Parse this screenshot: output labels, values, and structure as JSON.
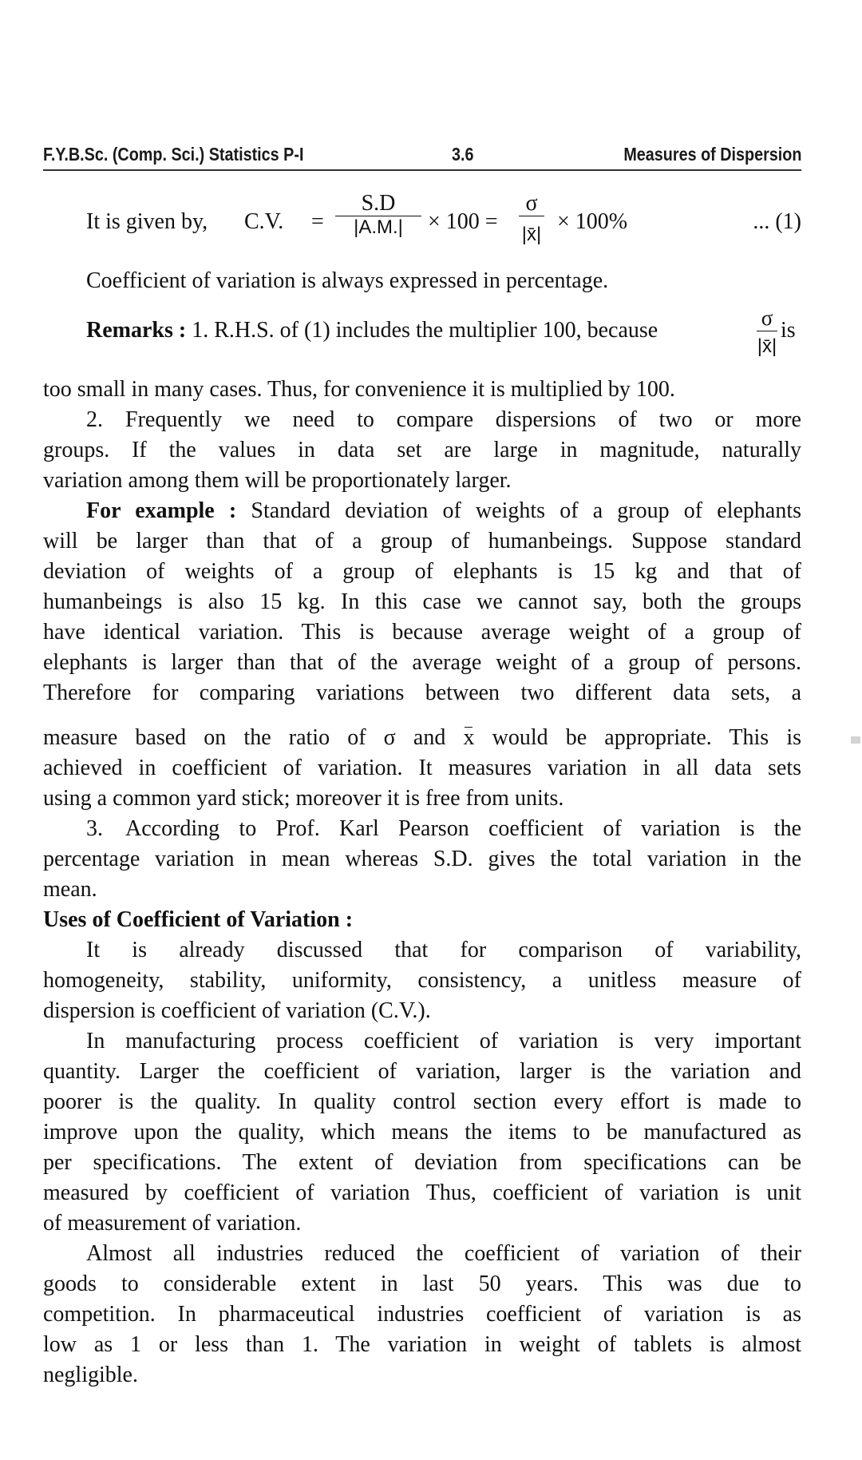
{
  "header": {
    "left": "F.Y.B.Sc. (Comp. Sci.) Statistics P-I",
    "center": "3.6",
    "right": "Measures of Dispersion"
  },
  "formula": {
    "lead": "It is given by,",
    "cv": "C.V.",
    "eq1": "=",
    "frac1_num": "S.D",
    "frac1_den": "|A.M.|",
    "times100": "× 100 =",
    "frac2_num": "σ",
    "frac2_den": "|x̄|",
    "times100pct": "× 100%",
    "eq_number": "... (1)"
  },
  "line_expressed": "Coefficient of variation is always expressed in percentage.",
  "remarks": {
    "label": "Remarks :",
    "text": "1. R.H.S. of (1) includes the multiplier 100, because",
    "frac_num": "σ",
    "frac_den": "|x̄|",
    "is": "is",
    "line2": "too small in many cases. Thus, for convenience it is multiplied by 100."
  },
  "point2": {
    "lines": [
      "2. Frequently we need to compare dispersions of two or more",
      "groups. If the values in data set are large in magnitude, naturally",
      "variation among them will be proportionately larger."
    ]
  },
  "example": {
    "label": "For example :",
    "first": "Standard deviation of weights of a group of elephants",
    "lines": [
      "will be larger than that of a group of humanbeings. Suppose standard",
      "deviation of weights of a group of elephants is 15 kg and that of",
      "humanbeings is also 15 kg. In this case we cannot say, both the groups",
      "have identical variation. This is because average weight of a group of",
      "elephants is larger than that of the average weight of a group of persons.",
      "Therefore for comparing variations between two different data sets, a"
    ],
    "ratio_a": "measure based on the ratio of σ and",
    "ratio_x": "x",
    "ratio_b": "would be appropriate. This is",
    "lines2": [
      "achieved in coefficient of variation. It measures variation in all data sets",
      "using a common yard stick; moreover it is free from units."
    ]
  },
  "point3": {
    "lines": [
      "3. According to Prof. Karl Pearson coefficient of variation is the",
      "percentage variation in mean whereas S.D. gives the total variation in the",
      "mean."
    ]
  },
  "uses": {
    "heading": "Uses of Coefficient of Variation :",
    "p1": [
      "It is already discussed that for comparison of variability,",
      "homogeneity, stability, uniformity, consistency, a unitless measure of",
      "dispersion is coefficient of variation (C.V.)."
    ],
    "p2": [
      "In manufacturing process coefficient of variation is very important",
      "quantity. Larger the coefficient of variation, larger is the variation and",
      "poorer is the quality. In quality control section every effort is made to",
      "improve upon the quality, which means the items to be manufactured as",
      "per specifications. The extent of deviation from specifications can be",
      "measured by coefficient of variation Thus, coefficient of variation is unit",
      "of measurement of variation."
    ],
    "p3": [
      "Almost all industries reduced the coefficient of variation of their",
      "goods to considerable extent in last 50 years. This was due to",
      "competition. In pharmaceutical industries coefficient of variation is as",
      "low as 1 or less than 1. The variation in weight of tablets is almost",
      "negligible."
    ]
  }
}
